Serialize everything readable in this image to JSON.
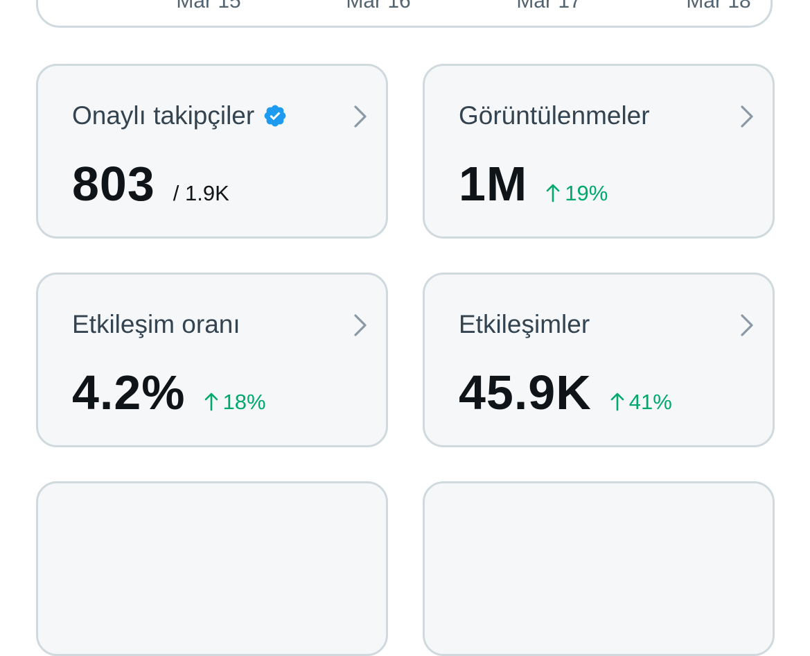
{
  "chart": {
    "x_ticks": [
      "Mar 15",
      "Mar 16",
      "Mar 17",
      "Mar 18"
    ]
  },
  "cards": [
    {
      "title": "Onaylı takipçiler",
      "value": "803",
      "total": "/ 1.9K",
      "icon": "verified-badge-icon"
    },
    {
      "title": "Görüntülenmeler",
      "value": "1M",
      "change": "19%"
    },
    {
      "title": "Etkileşim oranı",
      "value": "4.2%",
      "change": "18%"
    },
    {
      "title": "Etkileşimler",
      "value": "45.9K",
      "change": "41%"
    }
  ],
  "colors": {
    "accent_verified": "#1d9bf0",
    "positive_change": "#00a86b",
    "card_background": "#f5f7f8",
    "card_border": "#cfd9de",
    "chevron": "#8b98a5"
  }
}
